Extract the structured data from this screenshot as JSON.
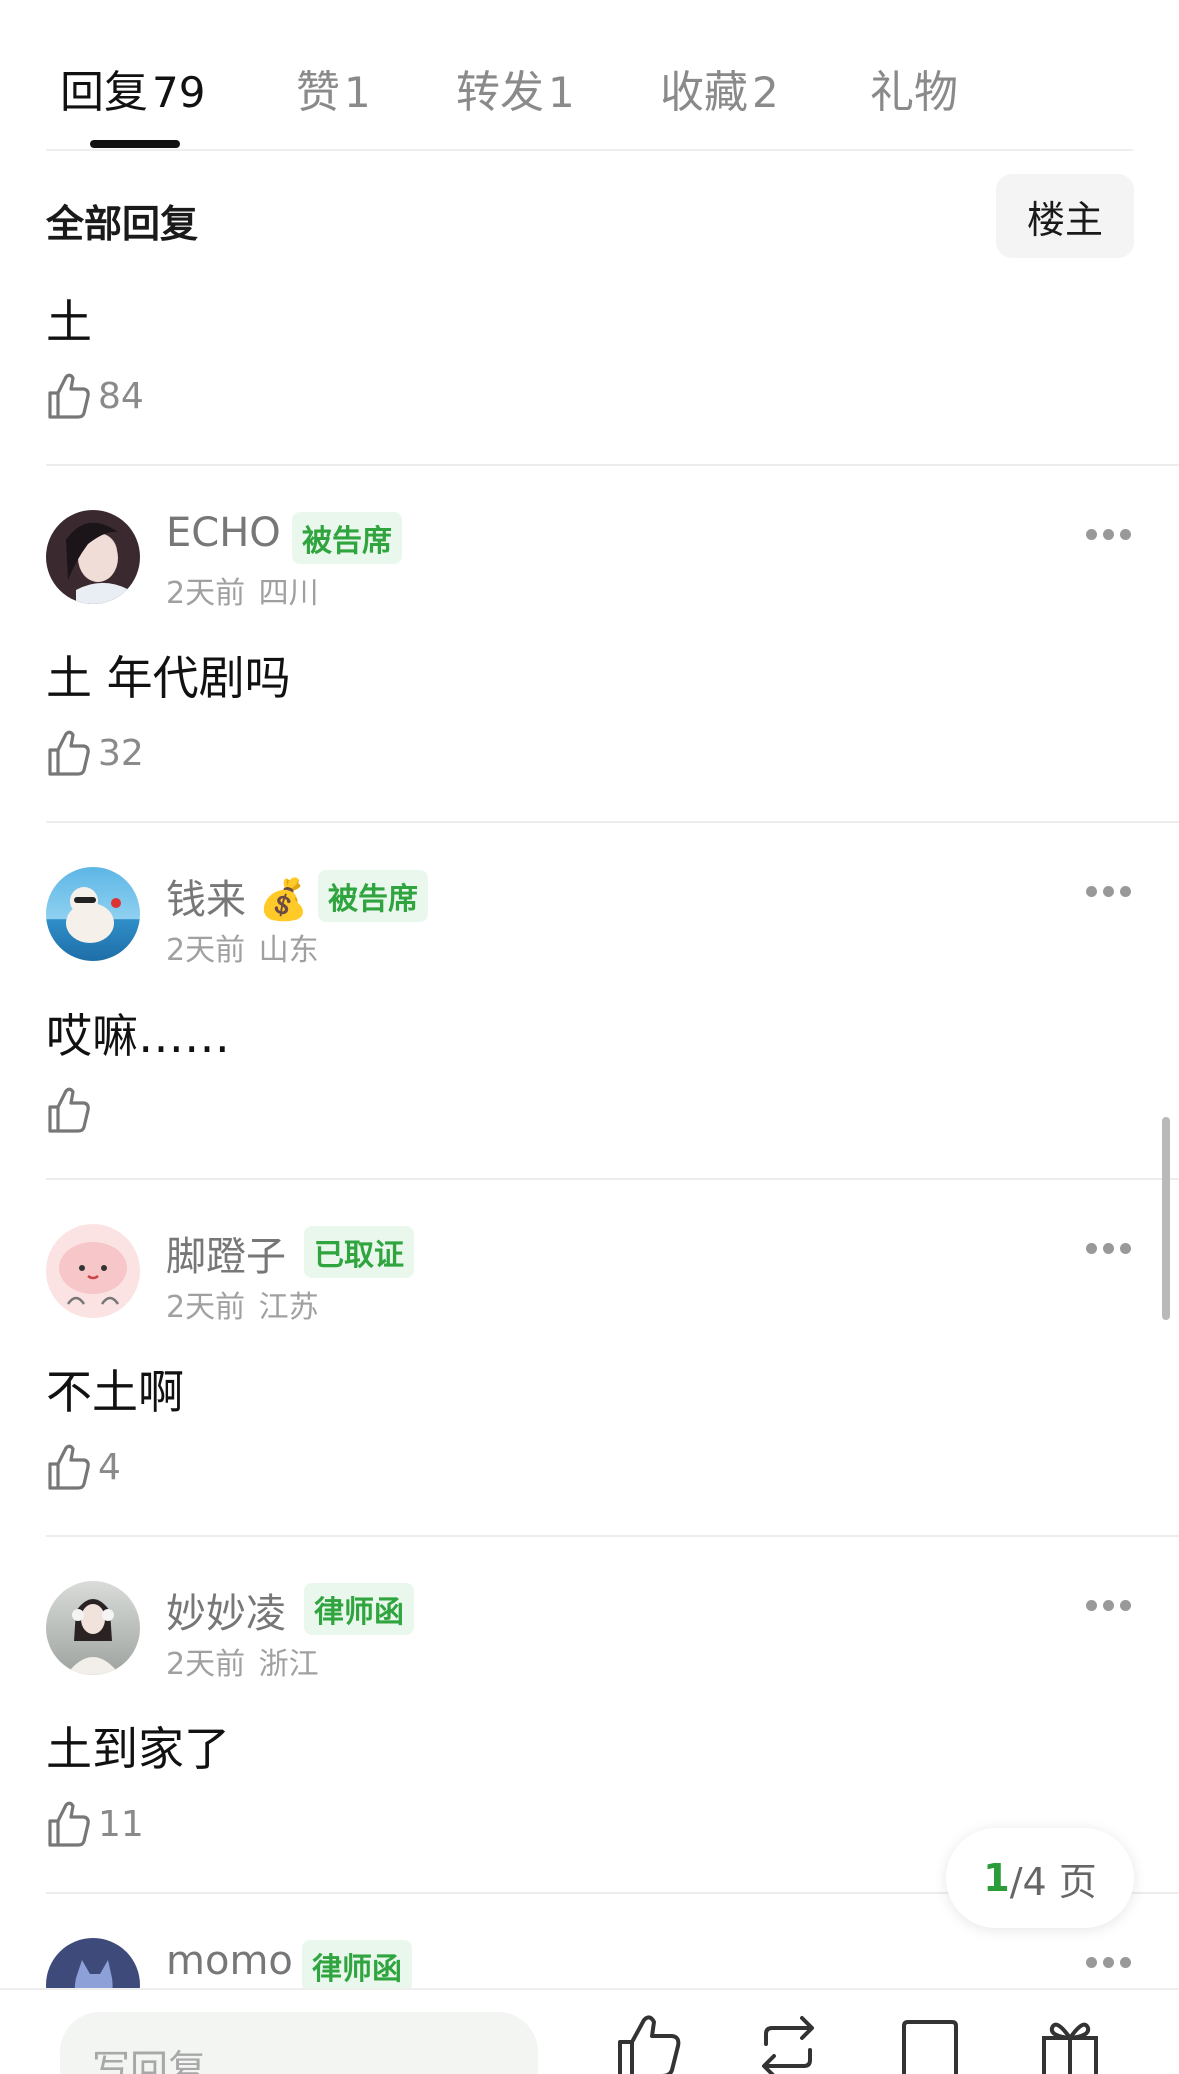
{
  "tabs": [
    {
      "label": "回复",
      "count": "79"
    },
    {
      "label": "赞",
      "count": "1"
    },
    {
      "label": "转发",
      "count": "1"
    },
    {
      "label": "收藏",
      "count": "2"
    },
    {
      "label": "礼物",
      "count": ""
    }
  ],
  "section": {
    "title": "全部回复",
    "filter_button": "楼主"
  },
  "top_comment": {
    "text": "土",
    "likes": "84"
  },
  "comments": [
    {
      "username": "ECHO",
      "badge": "被告席",
      "time": "2天前",
      "location": "四川",
      "text": "土 年代剧吗",
      "likes": "32"
    },
    {
      "username": "钱来",
      "emoji": "💰",
      "badge": "被告席",
      "time": "2天前",
      "location": "山东",
      "text": "哎嘛……",
      "likes": ""
    },
    {
      "username": "脚蹬子",
      "badge": "已取证",
      "time": "2天前",
      "location": "江苏",
      "text": "不土啊",
      "likes": "4"
    },
    {
      "username": "妙妙凌",
      "badge": "律师函",
      "time": "2天前",
      "location": "浙江",
      "text": "土到家了",
      "likes": "11"
    },
    {
      "username": "momo",
      "badge": "律师函"
    }
  ],
  "pagination": {
    "current": "1",
    "total_text": "/4 页"
  },
  "bottom_bar": {
    "reply_placeholder": "写回复"
  },
  "colors": {
    "accent_green": "#2fa43f",
    "badge_bg": "#eaf7ec"
  }
}
